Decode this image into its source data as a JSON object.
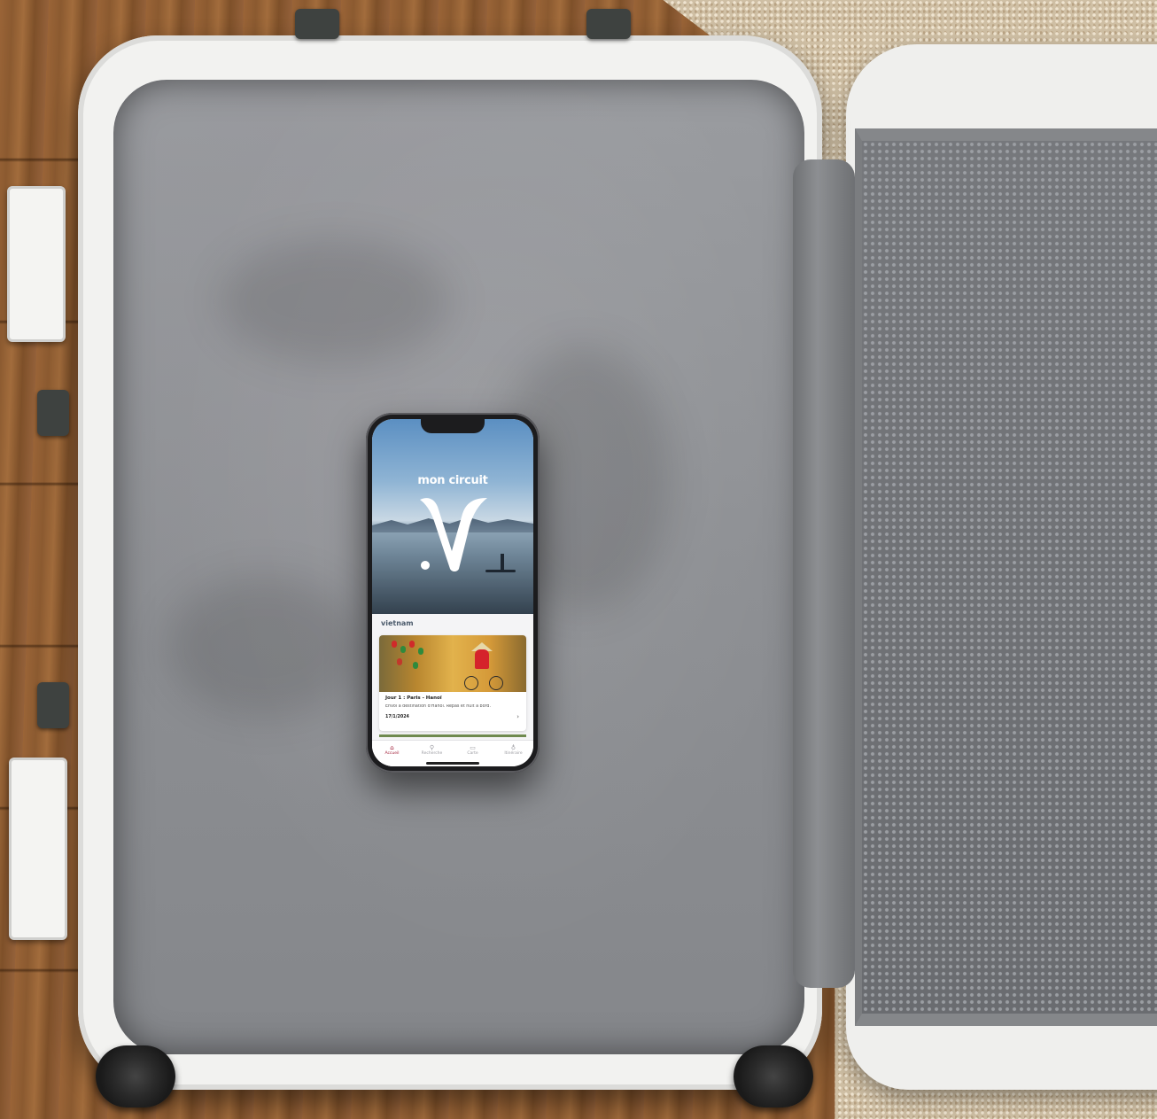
{
  "app": {
    "title": "mon circuit"
  },
  "section": {
    "title": "vietnam"
  },
  "card": {
    "title": "Jour 1 : Paris - Hanoï",
    "description": "Envol à destination d'Hanoï. Repas et nuit à bord.",
    "date": "17/1/2024",
    "chevron": "›"
  },
  "tabs": [
    {
      "label": "Accueil",
      "icon": "home-icon",
      "glyph": "⌂"
    },
    {
      "label": "Recherche",
      "icon": "search-icon",
      "glyph": "⚲"
    },
    {
      "label": "Carte",
      "icon": "map-icon",
      "glyph": "▭"
    },
    {
      "label": "Itinéraire",
      "icon": "pin-icon",
      "glyph": "♁"
    }
  ],
  "colors": {
    "accent": "#a2203a",
    "suitcase_lining": "#8d8f93",
    "shell": "#f2f2f0"
  }
}
